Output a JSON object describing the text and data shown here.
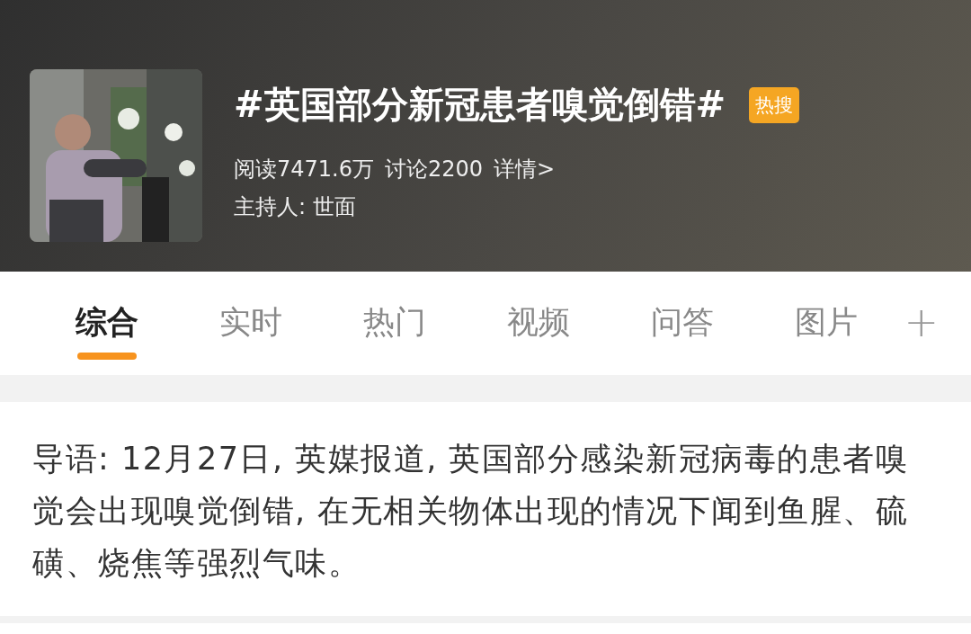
{
  "topic": {
    "title": "#英国部分新冠患者嗅觉倒错#",
    "badge": "热搜",
    "stats": [
      "阅读7471.6万",
      "讨论2200",
      "详情>"
    ],
    "host": "主持人: 世面"
  },
  "tabs": [
    {
      "label": "综合",
      "selected": true
    },
    {
      "label": "实时",
      "selected": false
    },
    {
      "label": "热门",
      "selected": false
    },
    {
      "label": "视频",
      "selected": false
    },
    {
      "label": "问答",
      "selected": false
    },
    {
      "label": "图片",
      "selected": false
    }
  ],
  "add_tab": "+",
  "intro": "导语: 12月27日, 英媒报道, 英国部分感染新冠病毒的患者嗅觉会出现嗅觉倒错, 在无相关物体出现的情况下闻到鱼腥、硫磺、烧焦等强烈气味。"
}
